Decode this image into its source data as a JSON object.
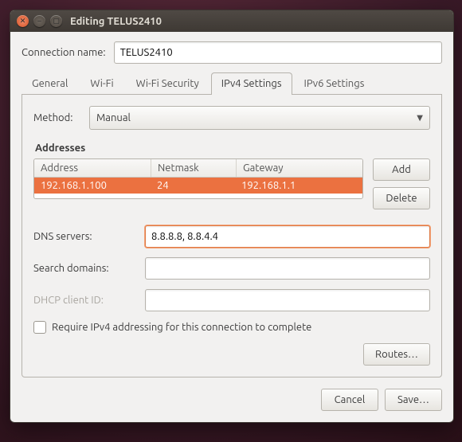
{
  "window": {
    "title": "Editing TELUS2410"
  },
  "connection_name": {
    "label": "Connection name:",
    "value": "TELUS2410"
  },
  "tabs": [
    "General",
    "Wi-Fi",
    "Wi-Fi Security",
    "IPv4 Settings",
    "IPv6 Settings"
  ],
  "active_tab": "IPv4 Settings",
  "method": {
    "label": "Method:",
    "value": "Manual"
  },
  "addresses": {
    "title": "Addresses",
    "headers": [
      "Address",
      "Netmask",
      "Gateway"
    ],
    "rows": [
      {
        "address": "192.168.1.100",
        "netmask": "24",
        "gateway": "192.168.1.1"
      }
    ],
    "add_label": "Add",
    "delete_label": "Delete"
  },
  "dns": {
    "label": "DNS servers:",
    "value": "8.8.8.8, 8.8.4.4"
  },
  "search": {
    "label": "Search domains:",
    "value": ""
  },
  "dhcp": {
    "label": "DHCP client ID:",
    "value": ""
  },
  "require_chk": {
    "label": "Require IPv4 addressing for this connection to complete",
    "checked": false
  },
  "routes_label": "Routes…",
  "footer": {
    "cancel": "Cancel",
    "save": "Save…"
  }
}
